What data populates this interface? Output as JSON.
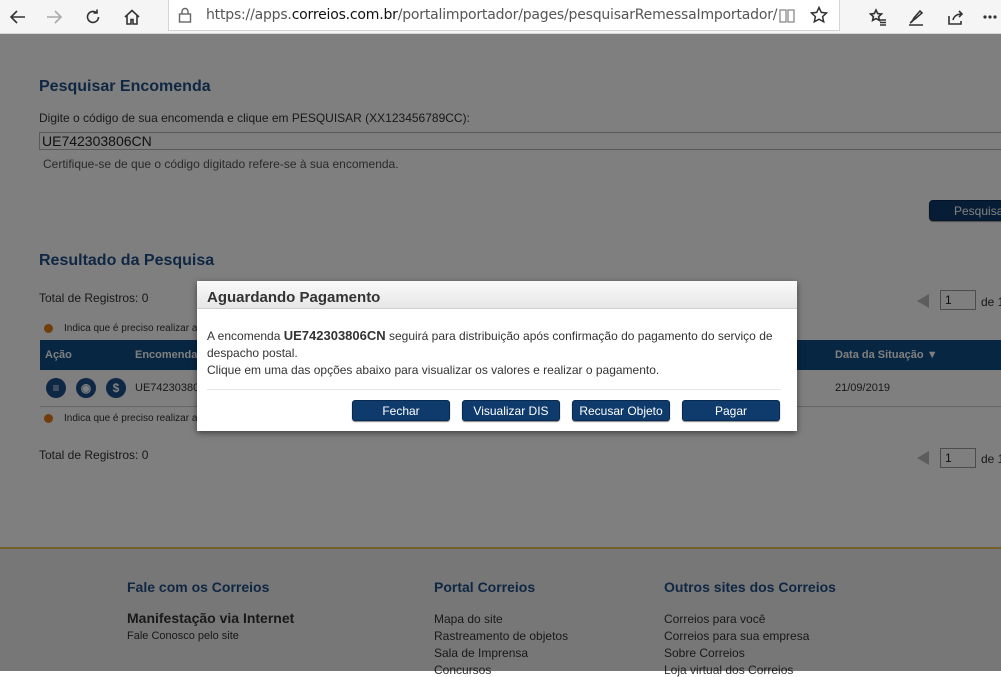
{
  "browser": {
    "url_prefix": "https://apps.",
    "url_domain": "correios.com.br",
    "url_path": "/portalimportador/pages/pesquisarRemessaImportador/pesquisarRem"
  },
  "search": {
    "title": "Pesquisar Encomenda",
    "instruction": "Digite o código de sua encomenda e clique em PESQUISAR (XX123456789CC):",
    "value": "UE742303806CN",
    "hint": "Certifique-se de que o código digitado refere-se à sua encomenda.",
    "button": "Pesquisar"
  },
  "results": {
    "title": "Resultado da Pesquisa",
    "total_top": "Total de Registros: 0",
    "total_bottom": "Total de Registros: 0",
    "legend_top": "Indica que é preciso realizar a",
    "legend_bottom": "Indica que é preciso realizar a",
    "page_value": "1",
    "page_of": "de 1",
    "headers": {
      "acao": "Ação",
      "encomenda": "Encomenda",
      "data_situacao": "Data da Situação ▼"
    },
    "row": {
      "encomenda": "UE74230380",
      "data": "21/09/2019"
    }
  },
  "modal": {
    "title": "Aguardando Pagamento",
    "line1_pre": "A encomenda ",
    "code": "UE742303806CN",
    "line1_post": " seguirá para distribuição após confirmação do pagamento do serviço de despacho postal.",
    "line2": "Clique em uma das opções abaixo para visualizar os valores e realizar o pagamento.",
    "buttons": [
      "Fechar",
      "Visualizar DIS",
      "Recusar Objeto",
      "Pagar"
    ]
  },
  "footer": {
    "col1": {
      "title": "Fale com os Correios",
      "bold_link": "Manifestação via Internet",
      "sub": "Fale Conosco pelo site"
    },
    "col2": {
      "title": "Portal Correios",
      "links": [
        "Mapa do site",
        "Rastreamento de objetos",
        "Sala de Imprensa",
        "Concursos"
      ]
    },
    "col3": {
      "title": "Outros sites dos Correios",
      "links": [
        "Correios para você",
        "Correios para sua empresa",
        "Sobre Correios",
        "Loja virtual dos Correios"
      ]
    }
  }
}
